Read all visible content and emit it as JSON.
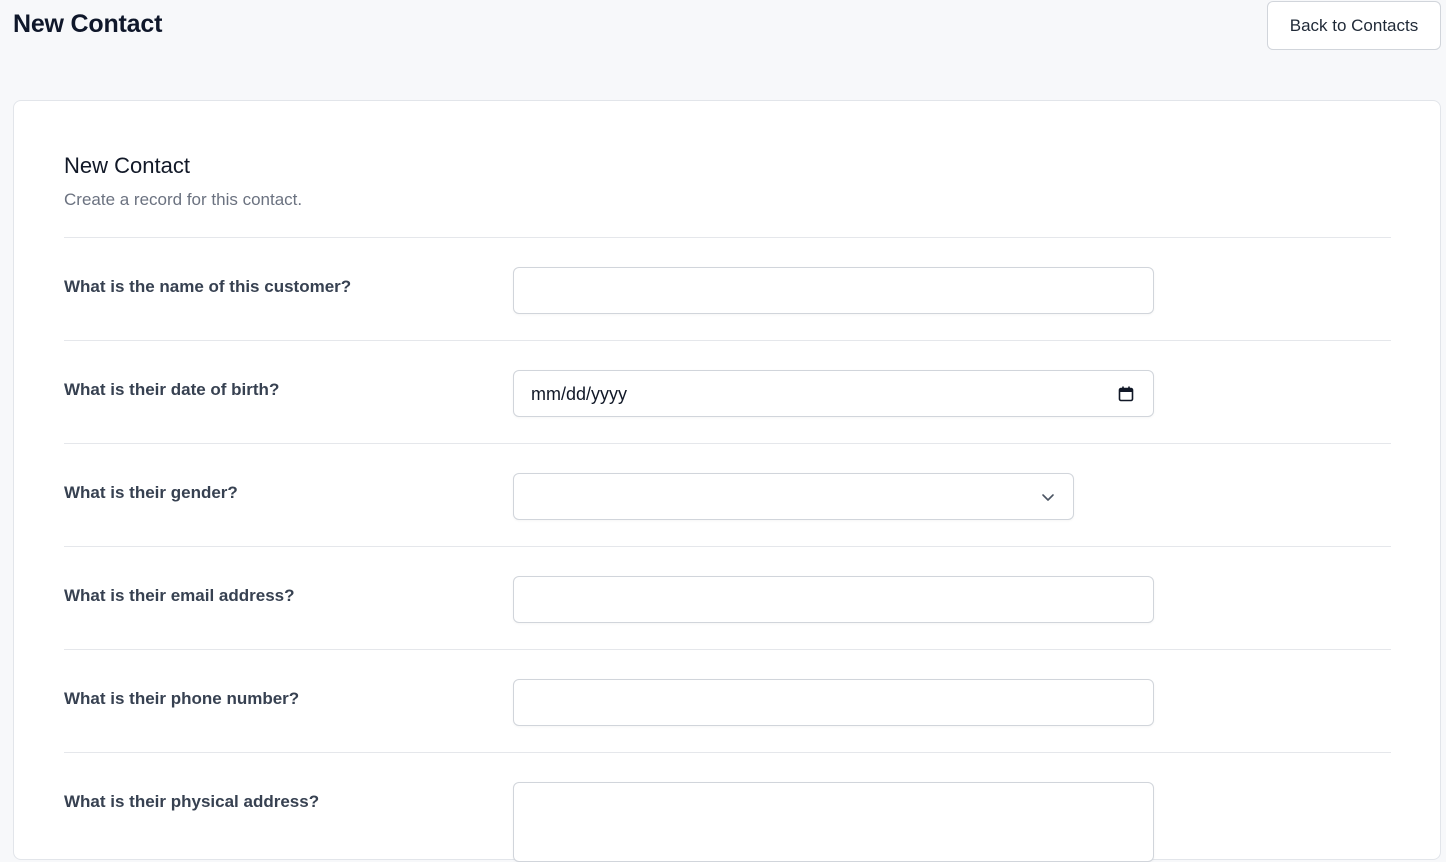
{
  "header": {
    "title": "New Contact",
    "back_button_label": "Back to Contacts"
  },
  "form": {
    "title": "New Contact",
    "subtitle": "Create a record for this contact.",
    "fields": [
      {
        "label": "What is the name of this customer?",
        "type": "text",
        "value": ""
      },
      {
        "label": "What is their date of birth?",
        "type": "date",
        "placeholder": "mm/dd/yyyy"
      },
      {
        "label": "What is their gender?",
        "type": "select",
        "value": ""
      },
      {
        "label": "What is their email address?",
        "type": "email",
        "value": ""
      },
      {
        "label": "What is their phone number?",
        "type": "tel",
        "value": ""
      },
      {
        "label": "What is their physical address?",
        "type": "textarea",
        "value": ""
      }
    ]
  },
  "icons": {
    "date_picker": "calendar-icon",
    "select_arrow": "chevron-down-icon"
  },
  "colors": {
    "page_background": "#f7f8fa",
    "card_background": "#ffffff",
    "border": "#d1d5db",
    "label_text": "#374151",
    "muted_text": "#6b7280"
  }
}
